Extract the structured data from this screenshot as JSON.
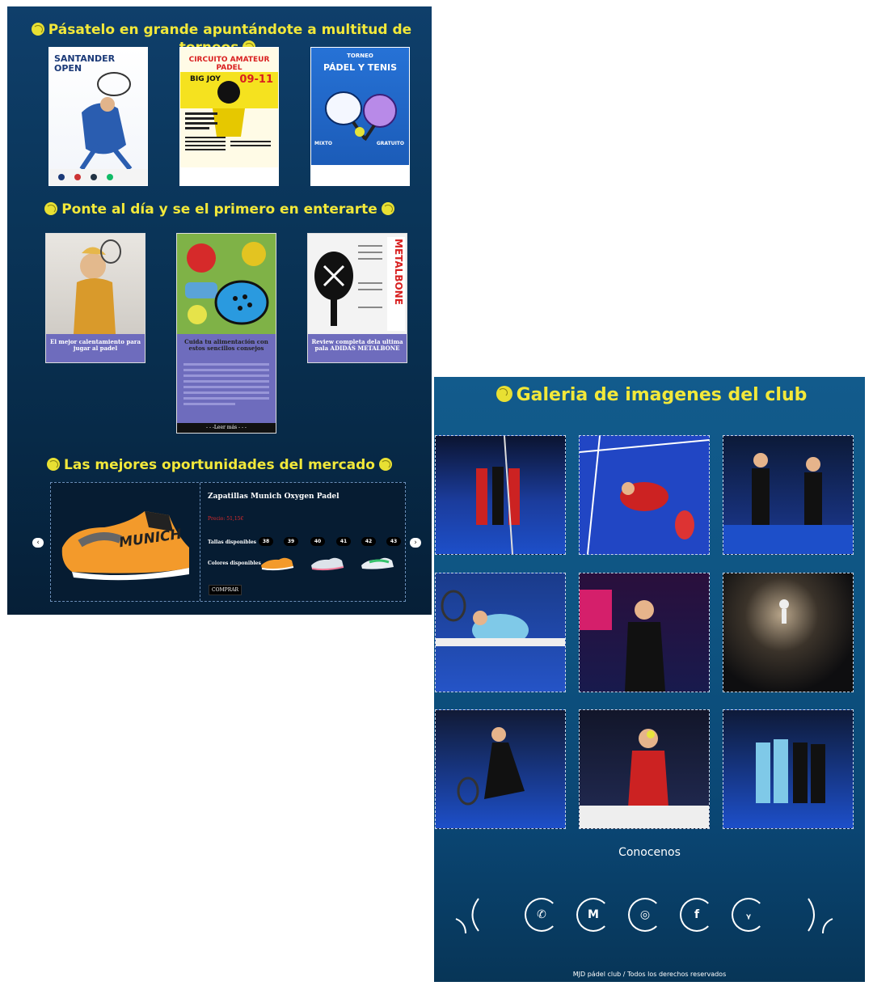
{
  "left": {
    "section1_title": "Pásatelo en grande apuntándote a multitud de torneos",
    "posters": [
      {
        "line1": "SANTANDER",
        "line2": "OPEN"
      },
      {
        "line1": "CIRCUITO AMATEUR PADEL",
        "line2": "BIG JOY",
        "line3": "09-11"
      },
      {
        "line1": "TORNEO",
        "line2": "PÁDEL Y TENIS",
        "line3": "MIXTO",
        "line4": "GRATUITO"
      }
    ],
    "section2_title": "Ponte al día y se el primero en enterarte",
    "cards": [
      {
        "caption": "El mejor calentamiento para jugar al padel"
      },
      {
        "caption": "Cuida tu alimentación con estos sencillos consejos",
        "read_more": "- - -Leer más - - -"
      },
      {
        "caption": "Review completa dela ultima pala ADIDAS METALBONE",
        "brand": "METALBONE"
      }
    ],
    "section3_title": "Las mejores oportunidades del mercado",
    "product": {
      "name": "Zapatillas Munich Oxygen Padel",
      "price": "Precio: 51,15€",
      "sizes_label": "Tallas disponibles",
      "sizes": [
        "38",
        "39",
        "40",
        "41",
        "42",
        "43"
      ],
      "colors_label": "Colores disponibles",
      "buy_label": "COMPRAR",
      "brand": "MUNICH"
    },
    "prev_icon": "‹",
    "next_icon": "›"
  },
  "right": {
    "gallery_title": "Galeria de imagenes del club",
    "about": "Conocenos",
    "social": [
      "whatsapp-icon",
      "gmail-icon",
      "instagram-icon",
      "facebook-icon",
      "twitter-icon"
    ],
    "footer": "MJD pádel club / Todos los derechos reservados"
  }
}
